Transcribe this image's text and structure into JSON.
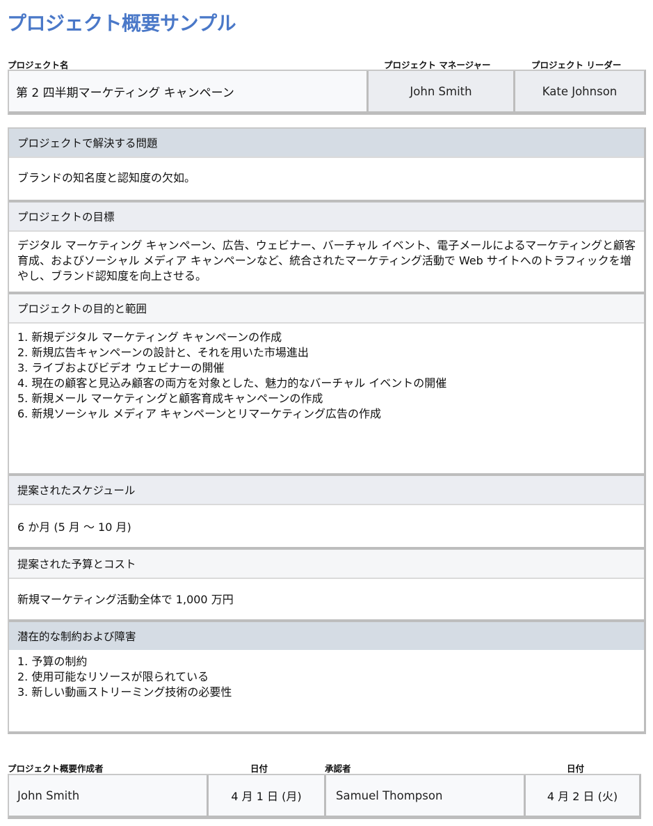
{
  "document": {
    "title": "プロジェクト概要サンプル"
  },
  "header_table": {
    "project_name_label": "プロジェクト名",
    "project_name": "第 2 四半期マーケティング キャンペーン",
    "manager_label": "プロジェクト マネージャー",
    "manager": "John Smith",
    "leader_label": "プロジェクト リーダー",
    "leader": "Kate Johnson"
  },
  "sections": {
    "problem": {
      "heading": "プロジェクトで解決する問題",
      "text": "ブランドの知名度と認知度の欠如。"
    },
    "goal": {
      "heading": "プロジェクトの目標",
      "text": "デジタル マーケティング キャンペーン、広告、ウェビナー、バーチャル イベント、電子メールによるマーケティングと顧客育成、およびソーシャル メディア キャンペーンなど、統合されたマーケティング活動で Web サイトへのトラフィックを増やし、ブランド認知度を向上させる。"
    },
    "objectives": {
      "heading": "プロジェクトの目的と範囲",
      "items": [
        "1. 新規デジタル マーケティング キャンペーンの作成",
        "2. 新規広告キャンペーンの設計と、それを用いた市場進出",
        "3. ライブおよびビデオ ウェビナーの開催",
        "4. 現在の顧客と見込み顧客の両方を対象とした、魅力的なバーチャル イベントの開催",
        "5. 新規メール マーケティングと顧客育成キャンペーンの作成",
        "6. 新規ソーシャル メディア キャンペーンとリマーケティング広告の作成"
      ]
    },
    "schedule": {
      "heading": "提案されたスケジュール",
      "text": "6 か月 (5 月 ～ 10 月)"
    },
    "budget": {
      "heading": "提案された予算とコスト",
      "text": "新規マーケティング活動全体で 1,000 万円"
    },
    "constraints": {
      "heading": "潜在的な制約および障害",
      "items": [
        "1. 予算の制約",
        "2. 使用可能なリソースが限られている",
        "3. 新しい動画ストリーミング技術の必要性"
      ]
    }
  },
  "signoff": {
    "author_label": "プロジェクト概要作成者",
    "author": "John Smith",
    "author_date_label": "日付",
    "author_date": "4 月 1 日 (月)",
    "approver_label": "承認者",
    "approver": "Samuel Thompson",
    "approver_date_label": "日付",
    "approver_date": "4 月 2 日 (火)"
  }
}
